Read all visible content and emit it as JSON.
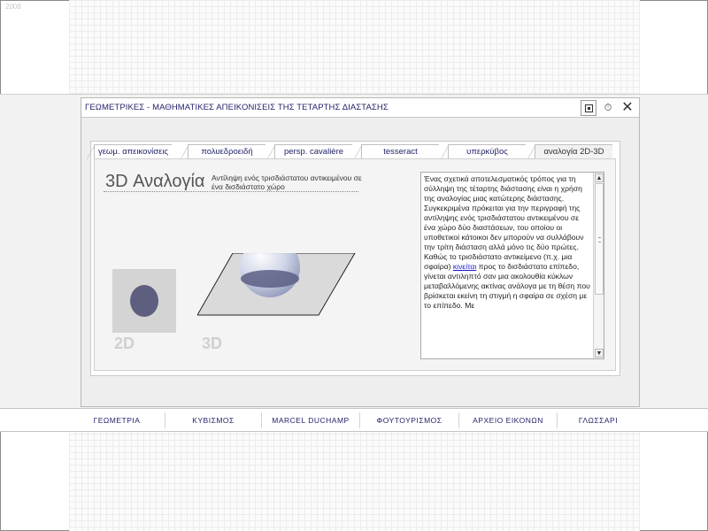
{
  "corner_label": "2008",
  "window": {
    "title": "ΓΕΩΜΕΤΡΙΚΕΣ - ΜΑΘΗΜΑΤΙΚΕΣ ΑΠΕΙΚΟΝΙΣΕΙΣ ΤΗΣ ΤΕΤΑΡΤΗΣ ΔΙΑΣΤΑΣΗΣ",
    "buttons": {
      "close": "✕",
      "timer": "⏱"
    }
  },
  "tabs": [
    {
      "label": "γεωμ. απεικονίσεις"
    },
    {
      "label": "πολυεδροειδή"
    },
    {
      "label": "persp. cavalière"
    },
    {
      "label": "tesseract"
    },
    {
      "label": "υπερκύβος"
    },
    {
      "label": "αναλογία 2D-3D"
    }
  ],
  "content": {
    "heading": "3D Αναλογία",
    "subtitle": "Αντίληψη ενός τρισδιάστατου αντικειμένου σε ένα δισδιάστατο χώρο",
    "label_2d": "2D",
    "label_3d": "3D",
    "text_before_link": "Ένας σχετικά αποτελεσματικός τρόπος για τη σύλληψη της τέταρτης διάστασης είναι η χρήση της αναλογίας μιας κατώτερης διάστασης. Συγκεκριμένα πρόκειται για την περιγραφή της αντίληψης ενός τρισδιάστατου αντικειμένου σε ένα χώρο δύο διαστάσεων, του οποίου οι υποθετικοί κάτοικοι δεν μπορούν να συλλάβουν την τρίτη διάσταση αλλά μόνο τις δύο πρώτες. Καθώς το τρισδιάστατο αντικείμενο (π.χ. μια σφαίρα) ",
    "link_text": "κινείται",
    "text_after_link": " προς το δισδιάστατο επίπεδο, γίνεται αντιληπτό σαν μια ακολουθία κύκλων μεταβαλλόμενης ακτίνας ανάλογα με τη θέση που βρίσκεται εκείνη τη στιγμή η σφαίρα σε σχέση με το επίπεδο. Με"
  },
  "nav": [
    {
      "label": "ΓΕΩΜΕΤΡΙΑ"
    },
    {
      "label": "ΚΥΒΙΣΜΟΣ"
    },
    {
      "label": "MARCEL DUCHAMP"
    },
    {
      "label": "ΦΟΥΤΟΥΡΙΣΜΟΣ"
    },
    {
      "label": "ΑΡΧΕΙΟ ΕΙΚΟΝΩΝ"
    },
    {
      "label": "ΓΛΩΣΣΑΡΙ"
    }
  ],
  "colors": {
    "title_text": "#23236b",
    "disc": "#5e5e7e",
    "link": "#1a1acc"
  }
}
